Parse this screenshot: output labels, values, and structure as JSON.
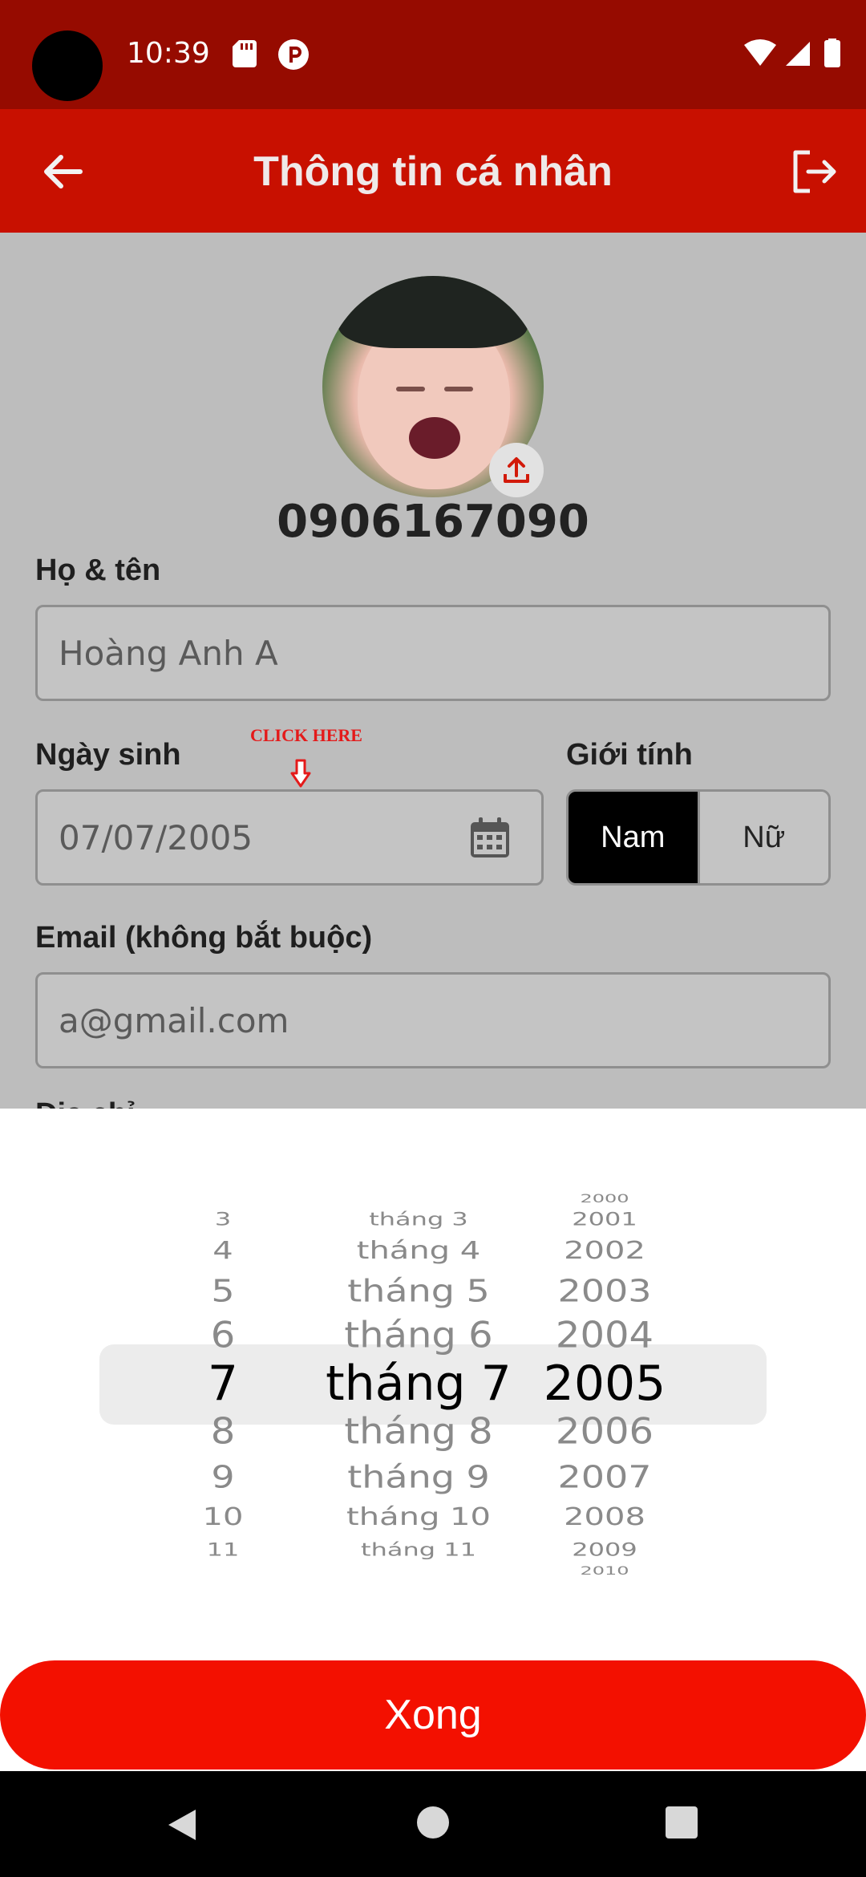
{
  "status_bar": {
    "time": "10:39"
  },
  "app_bar": {
    "title": "Thông tin cá nhân"
  },
  "profile": {
    "phone": "0906167090"
  },
  "form": {
    "name_label": "Họ & tên",
    "name_value": "Hoàng Anh A",
    "dob_label": "Ngày sinh",
    "dob_hint": "CLICK HERE",
    "dob_value": "07/07/2005",
    "gender_label": "Giới tính",
    "gender_options": [
      "Nam",
      "Nữ"
    ],
    "gender_selected": "Nam",
    "email_label": "Email (không bắt buộc)",
    "email_value": "a@gmail.com",
    "next_label_partial": "Địa chỉ"
  },
  "date_picker": {
    "days": [
      "3",
      "4",
      "5",
      "6",
      "7",
      "8",
      "9",
      "10",
      "11"
    ],
    "months": [
      "tháng 3",
      "tháng 4",
      "tháng 5",
      "tháng 6",
      "tháng 7",
      "tháng 8",
      "tháng 9",
      "tháng 10",
      "tháng 11"
    ],
    "years": [
      "2000",
      "2001",
      "2002",
      "2003",
      "2004",
      "2005",
      "2006",
      "2007",
      "2008",
      "2009",
      "2010"
    ],
    "selected": {
      "day": "7",
      "month": "tháng 7",
      "year": "2005"
    },
    "done_label": "Xong"
  },
  "colors": {
    "status_bar": "#960b00",
    "app_bar": "#c81000",
    "accent": "#f31000",
    "selected_gender": "#000000"
  }
}
